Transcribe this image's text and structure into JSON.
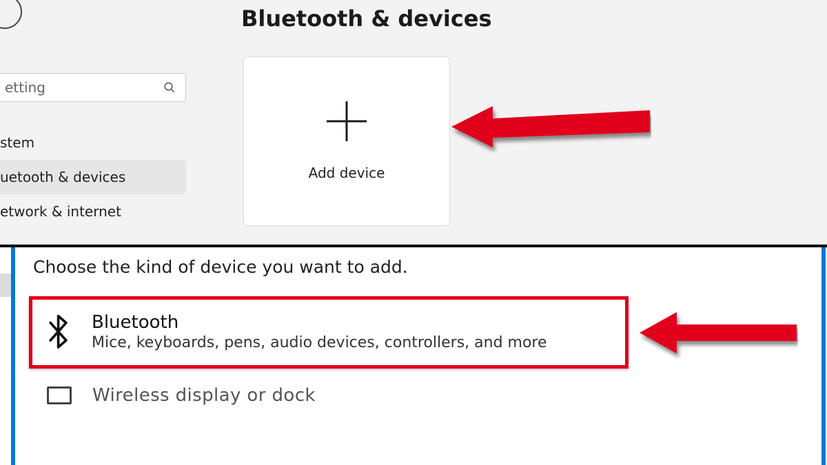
{
  "header": {
    "title": "Bluetooth & devices"
  },
  "search": {
    "placeholder": "etting"
  },
  "sidebar": {
    "items": [
      {
        "label": "stem",
        "selected": false
      },
      {
        "label": "uetooth & devices",
        "selected": true
      },
      {
        "label": "etwork & internet",
        "selected": false
      }
    ]
  },
  "add_tile": {
    "label": "Add device"
  },
  "dialog": {
    "heading": "Choose the kind of device you want to add.",
    "options": [
      {
        "icon": "bluetooth-icon",
        "title": "Bluetooth",
        "subtitle": "Mice, keyboards, pens, audio devices, controllers, and more",
        "highlighted": true
      },
      {
        "icon": "display-icon",
        "title": "Wireless display or dock",
        "highlighted": false
      }
    ]
  },
  "annotations": {
    "arrow_color": "#e1001a"
  }
}
